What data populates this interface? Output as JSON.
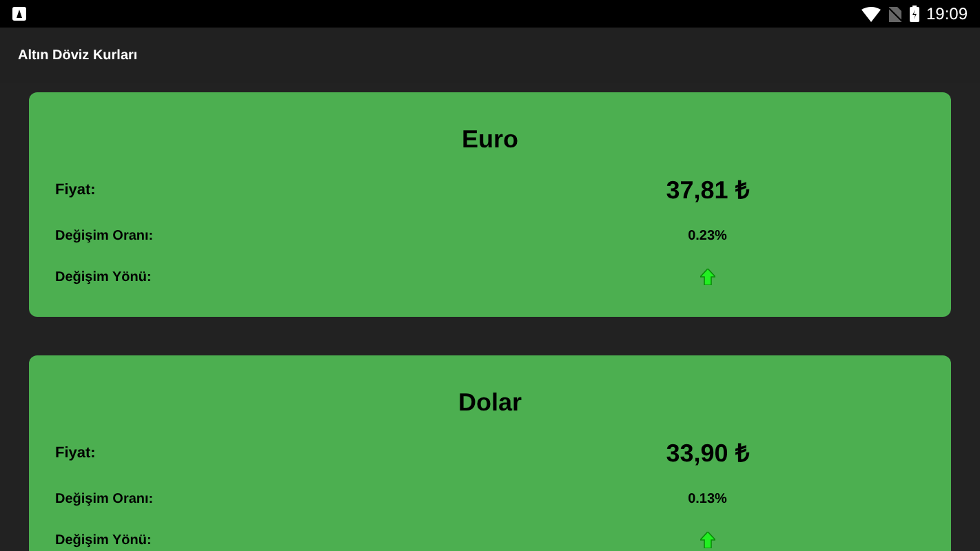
{
  "status_bar": {
    "time": "19:09"
  },
  "app_bar": {
    "title": "Altın Döviz Kurları"
  },
  "cards": [
    {
      "title": "Euro",
      "price_label": "Fiyat:",
      "price": "37,81 ₺",
      "rate_label": "Değişim Oranı:",
      "rate": "0.23%",
      "direction_label": "Değişim Yönü:",
      "kind": "up"
    },
    {
      "title": "Dolar",
      "price_label": "Fiyat:",
      "price": "33,90 ₺",
      "rate_label": "Değişim Oranı:",
      "rate": "0.13%",
      "direction_label": "Değişim Yönü:",
      "kind": "up"
    }
  ]
}
